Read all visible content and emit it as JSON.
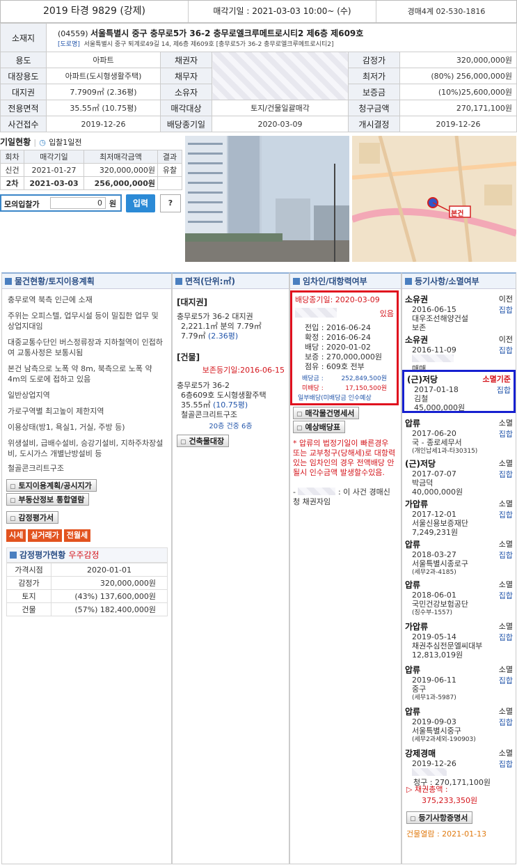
{
  "header": {
    "case_no": "2019 타경 9829 (강제)",
    "sale_date": "매각기일 : 2021-03-03 10:00~ (수)",
    "contact": "경매4계 02-530-1816"
  },
  "location": {
    "label": "소재지",
    "zipcode": "(04559)",
    "address": "서울특별시 중구 충무로5가 36-2 충무로엘크루메트로시티2 제6층 제609호",
    "map_link": "[도로명]",
    "road_address": "서울특별시 중구 퇴계로49길 14, 제6층 제609호 [충무로5가 36-2 충무로엘크루메트로시티2]"
  },
  "rows": [
    {
      "l1": "용도",
      "v1": "아파트",
      "l2": "채권자",
      "v2": "",
      "l3": "감정가",
      "v3": "320,000,000원"
    },
    {
      "l1": "대장용도",
      "v1": "아파트(도시형생활주택)",
      "l2": "채무자",
      "v2": "",
      "l3": "최저가",
      "v3": "(80%) 256,000,000원"
    },
    {
      "l1": "대지권",
      "v1": "7.7909㎡ (2.36평)",
      "l2": "소유자",
      "v2": "",
      "l3": "보증금",
      "v3": "(10%)25,600,000원"
    },
    {
      "l1": "전용면적",
      "v1": "35.55㎡ (10.75평)",
      "l2": "매각대상",
      "v2": "토지/건물일괄매각",
      "l3": "청구금액",
      "v3": "270,171,100원"
    },
    {
      "l1": "사건접수",
      "v1": "2019-12-26",
      "l2": "배당종기일",
      "v2": "2020-03-09",
      "l3": "개시결정",
      "v3": "2019-12-26"
    }
  ],
  "bid": {
    "title": "기일현황",
    "toggle": "입찰1일전",
    "headers": [
      "회차",
      "매각기일",
      "최저매각금액",
      "결과"
    ],
    "rows": [
      [
        "신건",
        "2021-01-27",
        "320,000,000원",
        "유찰"
      ],
      [
        "2차",
        "2021-03-03",
        "256,000,000원",
        ""
      ]
    ],
    "mock_label": "모의입찰가",
    "mock_value": "0",
    "mock_unit": "원",
    "submit": "입력",
    "help": "?"
  },
  "map": {
    "marker": "본건"
  },
  "col1": {
    "title": "물건현황/토지이용계획",
    "lines": [
      "충무로역 북측 인근에 소재",
      "주위는 오피스텔, 업무시설 등이 밀집한 업무 및 상업지대임",
      "대중교통수단인 버스정류장과 지하철역이 인접하여 교통사정은 보통시됨",
      "본건 남측으로 노폭 약 8m, 북측으로 노폭 약 4m의 도로에 접하고 있음",
      "일반상업지역",
      "가로구역별 최고높이 제한지역",
      "이용상태(방1, 욕실1, 거실, 주방 등)",
      "위생설비, 급배수설비, 승강기설비, 지하주차장설비, 도시가스 개별난방설비 등",
      "철골콘크리트구조"
    ],
    "btn1": "토지이용계획/공시지가",
    "btn2": "부동산정보 통합열람",
    "btn3": "감정평가서",
    "orange": [
      "시세",
      "실거래가",
      "전월세"
    ],
    "apprais_title": "감정평가현황",
    "apprais_org": "우주감정",
    "apprais_rows": [
      [
        "가격시점",
        "2020-01-01"
      ],
      [
        "감정가",
        "320,000,000원"
      ],
      [
        "토지",
        "(43%) 137,600,000원"
      ],
      [
        "건물",
        "(57%) 182,400,000원"
      ]
    ]
  },
  "col2": {
    "title": "면적(단위:㎡)",
    "land_head": "[대지권]",
    "land_1": "충무로5가 36-2 대지권",
    "land_2": "2,221.1㎡ 분의 7.79㎡",
    "land_3a": "7.79㎡",
    "land_3b": "(2.36평)",
    "bld_head": "[건물]",
    "bld_date": "보존등기일:2016-06-15",
    "bld_1": "충무로5가 36-2",
    "bld_2": "6층609호 도시형생활주택",
    "bld_3a": "35.55㎡",
    "bld_3b": "(10.75평)",
    "bld_4": "철골콘크리트구조",
    "bld_5": "20층 건중 6층",
    "btn": "건축물대장"
  },
  "col3": {
    "title": "임차인/대항력여부",
    "deadline": "배당종기일: 2020-03-09",
    "exists": "있음",
    "moved": "전입 : 2016-06-24",
    "confirm": "확정 : 2016-06-24",
    "dividend": "배당 : 2020-01-02",
    "deposit": "보증 : 270,000,000원",
    "occupy": "점유 : 609호 전부",
    "div_amt_l": "배당금 :",
    "div_amt": "252,849,500원",
    "undiv_l": "미배당 :",
    "undiv": "17,150,500원",
    "note": "일부배당(미배당금 인수예상",
    "btn1": "매각물건명세서",
    "btn2": "예상배당표",
    "warn": "* 압류의 법정기일이 빠른경우 또는 교부청구(당해세)로 대항력있는 임차인의 경우 전액배당 안될시 인수금액 발생할수있음.",
    "creditor_suffix": ": 이 사건 경매신청 채권자임",
    "creditor_prefix": "-"
  },
  "col4": {
    "title": "등기사항/소멸여부",
    "items": [
      {
        "kind": "소유권",
        "st": "이전",
        "l1": "2016-06-15",
        "l2": "대우조선해양건설",
        "l3": "보존"
      },
      {
        "kind": "소유권",
        "st": "이전",
        "l1": "2016-11-09",
        "l2": "",
        "l3": "매매"
      },
      {
        "kind": "(근)저당",
        "st": "소멸기준",
        "l1": "2017-01-18",
        "l2": "김철",
        "l3": "45,000,000원"
      },
      {
        "kind": "압류",
        "st": "소멸",
        "l1": "2017-06-20",
        "l2": "국 - 종로세무서",
        "l3": "(개인납세1과-타30315)"
      },
      {
        "kind": "(근)저당",
        "st": "소멸",
        "l1": "2017-07-07",
        "l2": "박금덕",
        "l3": "40,000,000원"
      },
      {
        "kind": "가압류",
        "st": "소멸",
        "l1": "2017-12-01",
        "l2": "서울신용보증재단",
        "l3": "7,249,231원"
      },
      {
        "kind": "압류",
        "st": "소멸",
        "l1": "2018-03-27",
        "l2": "서울특별시종로구",
        "l3": "(세무2과-4185)"
      },
      {
        "kind": "압류",
        "st": "소멸",
        "l1": "2018-06-01",
        "l2": "국민건강보험공단",
        "l3": "(징수부-1557)"
      },
      {
        "kind": "가압류",
        "st": "소멸",
        "l1": "2019-05-14",
        "l2": "채권추심전문엘씨대부",
        "l3": "12,813,019원"
      },
      {
        "kind": "압류",
        "st": "소멸",
        "l1": "2019-06-11",
        "l2": "중구",
        "l3": "(세무1과-5987)"
      },
      {
        "kind": "압류",
        "st": "소멸",
        "l1": "2019-09-03",
        "l2": "서울특별시중구",
        "l3": "(세무2과세외-190903)"
      },
      {
        "kind": "강제경매",
        "st": "소멸",
        "l1": "2019-12-26",
        "l2": "",
        "l3": "청구 : 270,171,100원"
      }
    ],
    "reg_mark": "집합",
    "total_l": "▷ 채권총액 :",
    "total": "375,233,350원",
    "btn": "등기사항증명서",
    "view": "건물열람 : 2021-01-13"
  }
}
